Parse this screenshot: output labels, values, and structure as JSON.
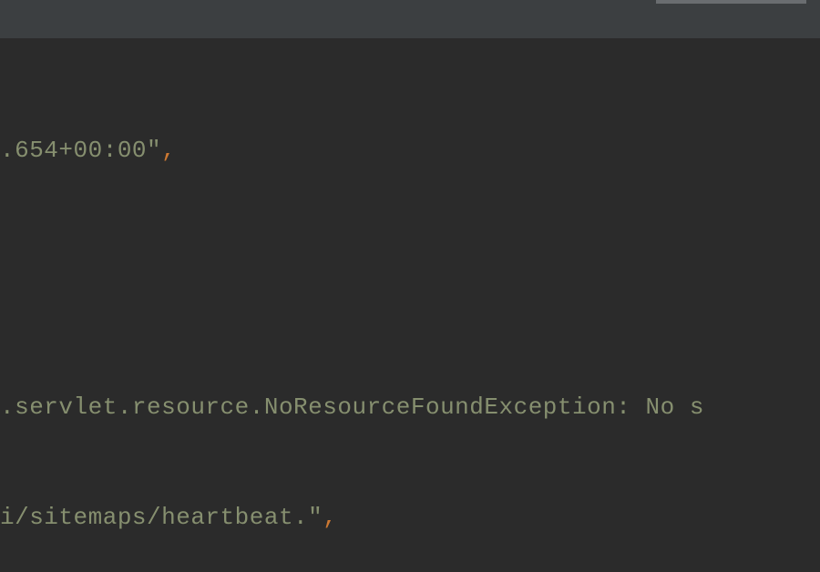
{
  "editor": {
    "lines": [
      {
        "segments": [
          {
            "text": ".654+00:00\"",
            "type": "string"
          },
          {
            "text": ",",
            "type": "comma"
          }
        ]
      },
      {
        "segments": [
          {
            "text": "",
            "type": "string"
          }
        ]
      },
      {
        "segments": [
          {
            "text": "",
            "type": "string"
          }
        ]
      },
      {
        "segments": [
          {
            "text": ".servlet.resource.NoResourceFoundException: No s",
            "type": "string"
          }
        ]
      },
      {
        "segments": [
          {
            "text": "i/sitemaps/heartbeat.\"",
            "type": "string"
          },
          {
            "text": ",",
            "type": "comma"
          }
        ]
      }
    ]
  },
  "colors": {
    "background": "#2b2b2b",
    "topBar": "#3c3f41",
    "stringText": "#868f6f",
    "comma": "#cc7832"
  }
}
